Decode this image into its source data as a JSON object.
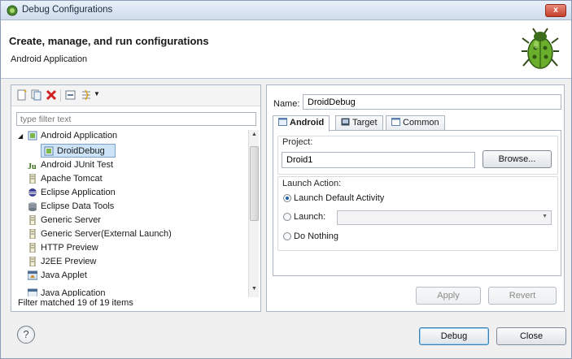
{
  "window": {
    "title": "Debug Configurations",
    "close_label": "x"
  },
  "banner": {
    "heading": "Create, manage, and run configurations",
    "subheading": "Android Application"
  },
  "left": {
    "filter_placeholder": "type filter text",
    "tree": [
      {
        "label": "Android Application",
        "icon": "android-app-icon",
        "level": 0,
        "expanded": true
      },
      {
        "label": "DroidDebug",
        "icon": "android-config-icon",
        "level": 1,
        "selected": true
      },
      {
        "label": "Android JUnit Test",
        "icon": "junit-icon",
        "level": 0
      },
      {
        "label": "Apache Tomcat",
        "icon": "server-icon",
        "level": 0
      },
      {
        "label": "Eclipse Application",
        "icon": "eclipse-icon",
        "level": 0
      },
      {
        "label": "Eclipse Data Tools",
        "icon": "database-icon",
        "level": 0
      },
      {
        "label": "Generic Server",
        "icon": "server-icon",
        "level": 0
      },
      {
        "label": "Generic Server(External Launch)",
        "icon": "server-icon",
        "level": 0
      },
      {
        "label": "HTTP Preview",
        "icon": "server-icon",
        "level": 0
      },
      {
        "label": "J2EE Preview",
        "icon": "server-icon",
        "level": 0
      },
      {
        "label": "Java Applet",
        "icon": "applet-icon",
        "level": 0
      },
      {
        "label": "Java Application",
        "icon": "java-app-icon",
        "level": 0
      }
    ],
    "status": "Filter matched 19 of 19 items"
  },
  "right": {
    "name_label": "Name:",
    "name_value": "DroidDebug",
    "tabs": [
      {
        "label": "Android",
        "active": true
      },
      {
        "label": "Target",
        "active": false
      },
      {
        "label": "Common",
        "active": false
      }
    ],
    "project_label": "Project:",
    "project_value": "Droid1",
    "browse_label": "Browse...",
    "launch_action_label": "Launch Action:",
    "radio_default": "Launch Default Activity",
    "radio_launch": "Launch:",
    "radio_nothing": "Do Nothing",
    "apply_label": "Apply",
    "revert_label": "Revert"
  },
  "footer": {
    "help_label": "?",
    "debug_label": "Debug",
    "close_label": "Close"
  },
  "colors": {
    "selection": "#cde3f7",
    "accent": "#3c7fb1",
    "delete_red": "#d12020"
  }
}
